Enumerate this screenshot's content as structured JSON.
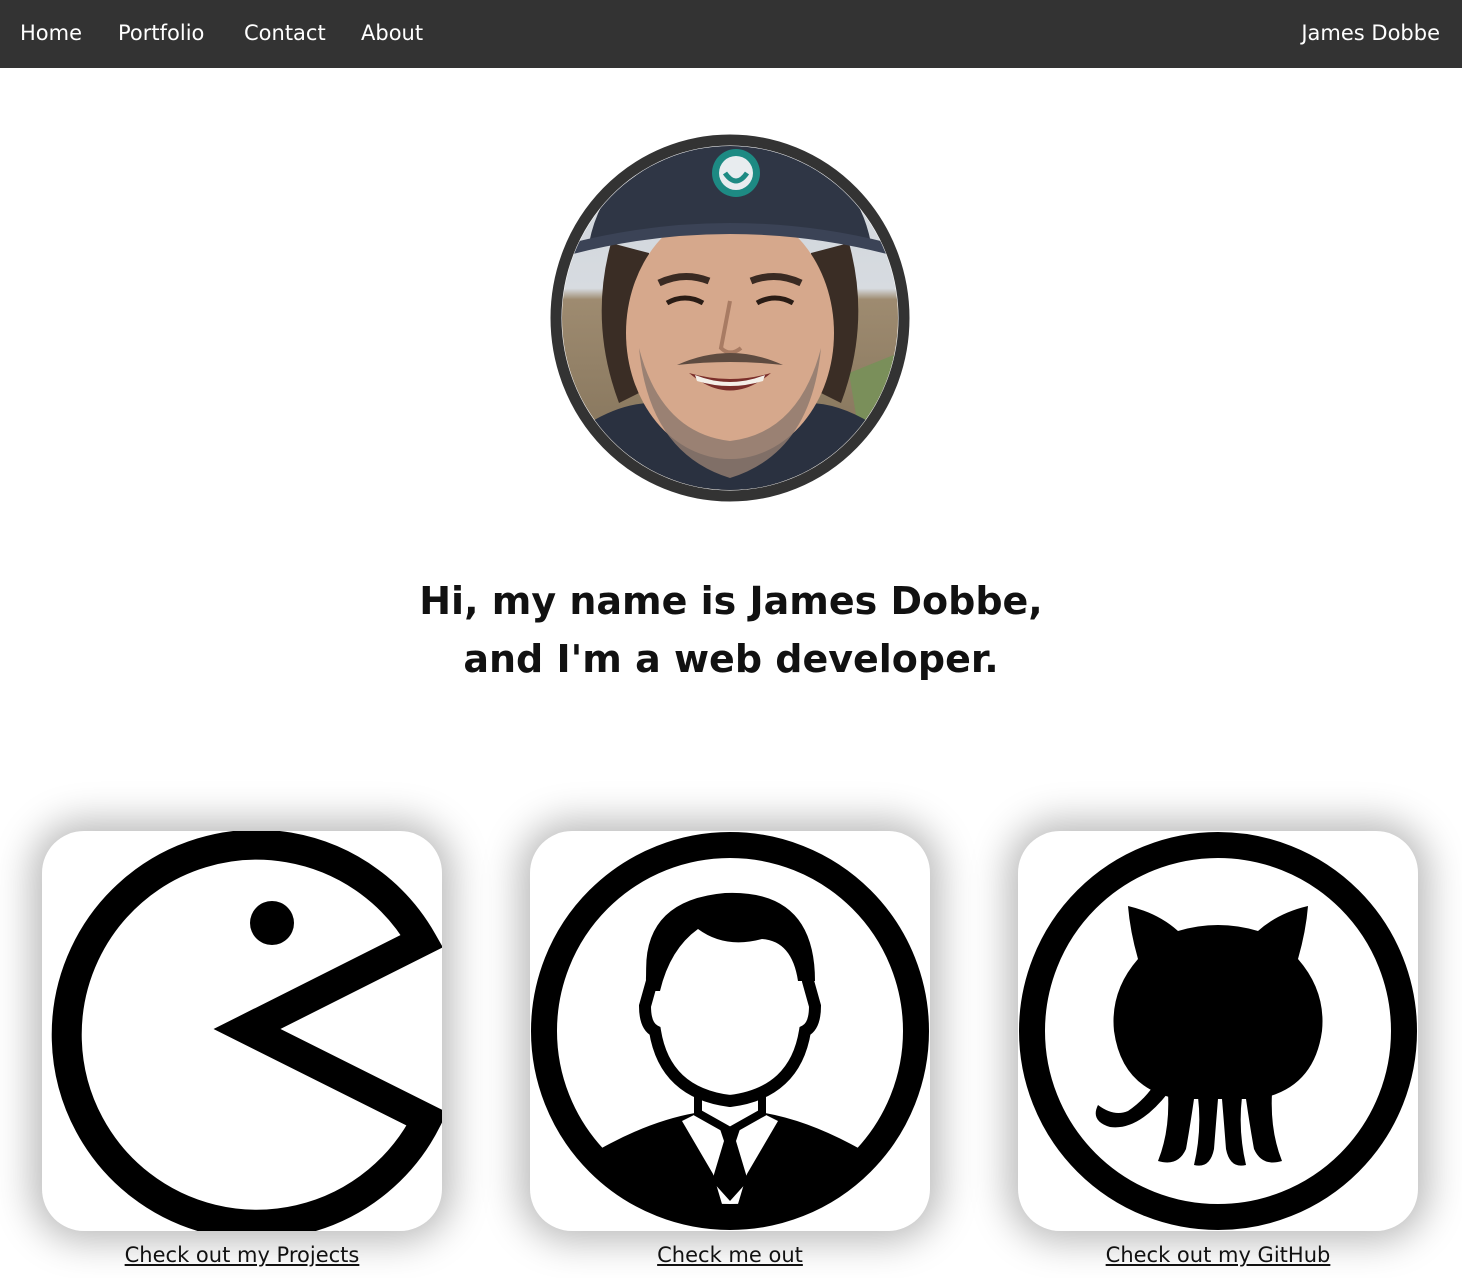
{
  "nav": {
    "links": [
      {
        "label": "Home"
      },
      {
        "label": "Portfolio"
      },
      {
        "label": "Contact"
      },
      {
        "label": "About"
      }
    ],
    "brand": "James Dobbe"
  },
  "hero": {
    "line1": "Hi, my name is James Dobbe,",
    "line2": "and I'm a web developer."
  },
  "cards": [
    {
      "icon": "pacman-icon",
      "caption": "Check out my Projects"
    },
    {
      "icon": "person-icon",
      "caption": "Check me out"
    },
    {
      "icon": "github-octocat-icon",
      "caption": "Check out my GitHub"
    }
  ],
  "colors": {
    "navbar_bg": "#333333",
    "nav_text": "#ffffff",
    "avatar_border": "#333333"
  }
}
